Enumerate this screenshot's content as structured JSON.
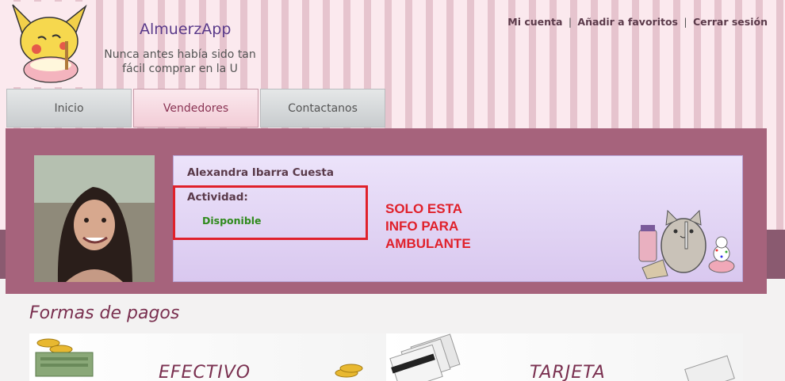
{
  "brand": {
    "title": "AlmuerzApp",
    "slogan": "Nunca antes había sido tan fácil comprar en la U"
  },
  "toplinks": {
    "account": "Mi cuenta",
    "favorites": "Añadir a favoritos",
    "logout": "Cerrar sesión",
    "separator": "|"
  },
  "tabs": [
    {
      "label": "Inicio"
    },
    {
      "label": "Vendedores"
    },
    {
      "label": "Contactanos"
    }
  ],
  "vendor": {
    "name": "Alexandra Ibarra Cuesta",
    "activity_label": "Actividad:",
    "status": "Disponible"
  },
  "annotation": {
    "note": "SOLO ESTA INFO PARA AMBULANTE"
  },
  "payments": {
    "title": "Formas de pagos",
    "methods": [
      {
        "label": "EFECTIVO"
      },
      {
        "label": "TARJETA"
      }
    ]
  },
  "colors": {
    "panel": "#a6637c",
    "accent": "#7a3050",
    "status_green": "#2f8a1c",
    "annotation_red": "#e0212b"
  }
}
